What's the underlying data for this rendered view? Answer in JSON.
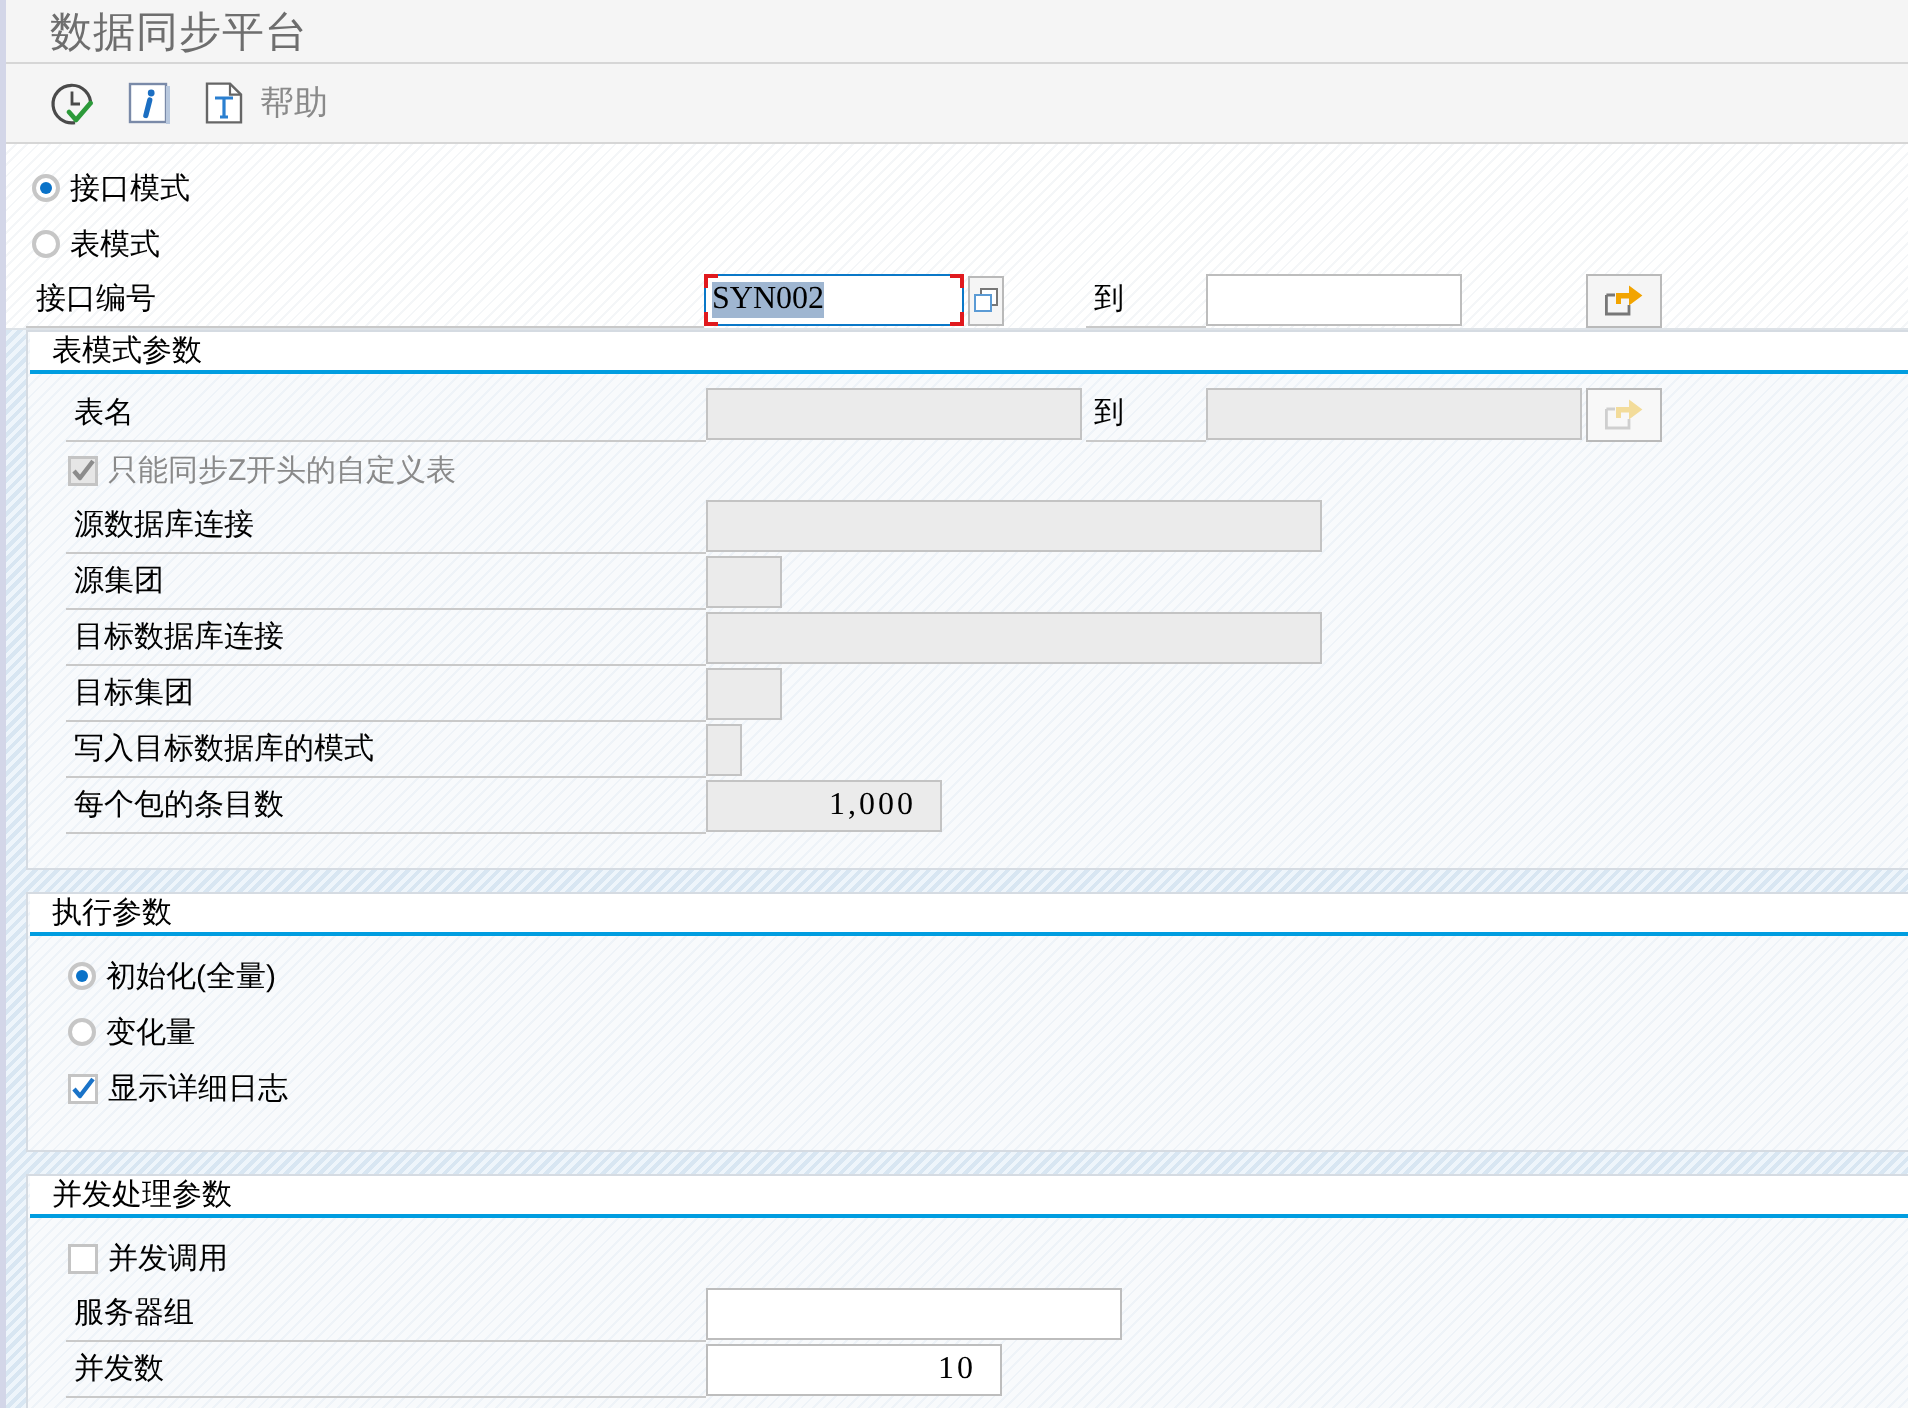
{
  "window": {
    "title": "数据同步平台"
  },
  "toolbar": {
    "buttons": [
      {
        "kind": "execute"
      },
      {
        "kind": "info"
      },
      {
        "kind": "help",
        "label": "帮助"
      }
    ]
  },
  "selection": {
    "modes": [
      {
        "label": "接口模式",
        "selected": true
      },
      {
        "label": "表模式",
        "selected": false
      }
    ],
    "interface": {
      "label": "接口编号",
      "value": "SYN002",
      "focused": true,
      "to_label": "到"
    }
  },
  "sections": [
    {
      "title": "表模式参数",
      "rows": [
        {
          "kind": "range",
          "label": "表名",
          "to_label": "到",
          "disabled": true
        },
        {
          "kind": "checkbox",
          "label": "只能同步Z开头的自定义表",
          "checked": true,
          "disabled": true
        },
        {
          "kind": "field",
          "label": "源数据库连接",
          "disabled": true
        },
        {
          "kind": "field",
          "label": "源集团",
          "disabled": true
        },
        {
          "kind": "field",
          "label": "目标数据库连接",
          "disabled": true
        },
        {
          "kind": "field",
          "label": "目标集团",
          "disabled": true
        },
        {
          "kind": "field",
          "label": "写入目标数据库的模式",
          "disabled": true
        },
        {
          "kind": "field",
          "label": "每个包的条目数",
          "value": "1,000",
          "disabled": true
        }
      ]
    },
    {
      "title": "执行参数",
      "rows": [
        {
          "kind": "radio",
          "label": "初始化(全量)",
          "selected": true,
          "disabled": false
        },
        {
          "kind": "radio",
          "label": "变化量",
          "selected": false,
          "disabled": false
        },
        {
          "kind": "checkbox",
          "label": "显示详细日志",
          "checked": true,
          "disabled": false
        }
      ]
    },
    {
      "title": "并发处理参数",
      "rows": [
        {
          "kind": "checkbox",
          "label": "并发调用",
          "checked": false,
          "disabled": false
        },
        {
          "kind": "field",
          "label": "服务器组",
          "disabled": false
        },
        {
          "kind": "field",
          "label": "并发数",
          "value": "10",
          "disabled": false
        }
      ]
    }
  ]
}
